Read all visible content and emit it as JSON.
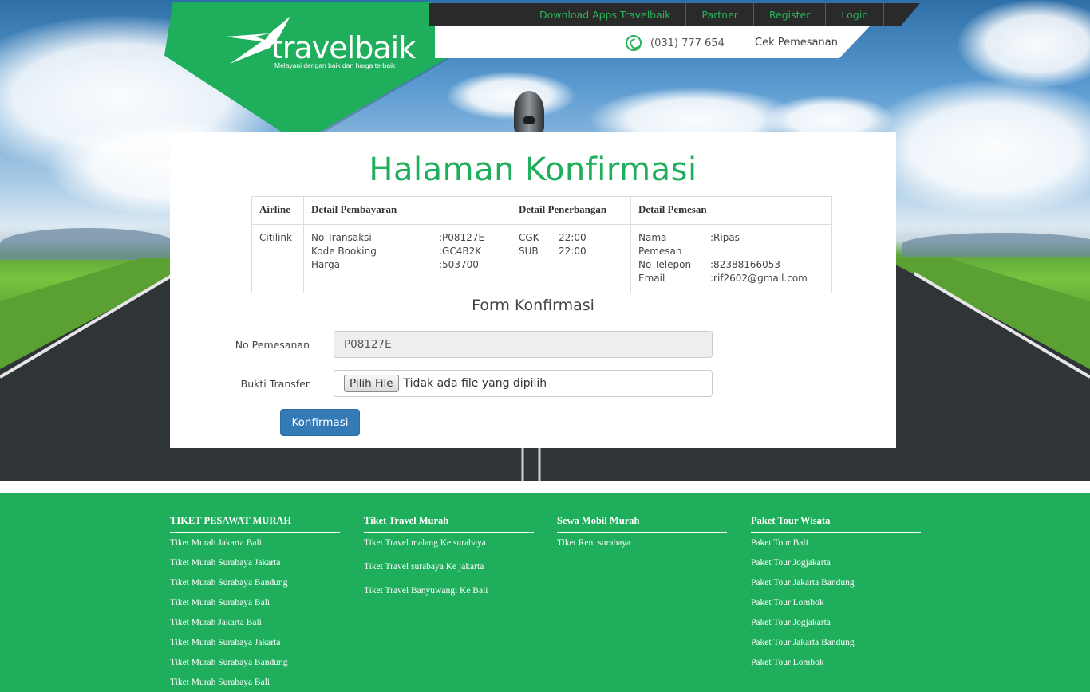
{
  "topnav": {
    "items": [
      "Download Apps Travelbaik",
      "Partner",
      "Register",
      "Login"
    ]
  },
  "contact": {
    "phone": "(031) 777 654",
    "cek_label": "Cek Pemesanan"
  },
  "logo": {
    "name": "travelbaik",
    "tagline": "Melayani dengan baik dan harga terbaik"
  },
  "page_title": "Halaman Konfirmasi",
  "detail_table": {
    "headers": [
      "Airline",
      "Detail Pembayaran",
      "Detail Penerbangan",
      "Detail Pemesan"
    ],
    "airline": "Citilink",
    "payment": [
      {
        "label": "No Transaksi",
        "value": ":P08127E"
      },
      {
        "label": "Kode Booking",
        "value": ":GC4B2K"
      },
      {
        "label": "Harga",
        "value": ":503700"
      }
    ],
    "flight": [
      {
        "code": "CGK",
        "time": "22:00"
      },
      {
        "code": "SUB",
        "time": "22:00"
      }
    ],
    "customer": [
      {
        "label": "Nama Pemesan",
        "value": ":Ripas"
      },
      {
        "label": "No Telepon",
        "value": ":82388166053"
      },
      {
        "label": "Email",
        "value": ":rif2602@gmail.com"
      }
    ]
  },
  "form": {
    "title": "Form Konfirmasi",
    "no_pemesanan_label": "No Pemesanan",
    "no_pemesanan_value": "P08127E",
    "bukti_label": "Bukti Transfer",
    "file_button": "Pilih File",
    "file_status": "Tidak ada file yang dipilih",
    "submit_label": "Konfirmasi"
  },
  "footer": {
    "columns": [
      {
        "heading": "TIKET PESAWAT MURAH",
        "links": [
          "Tiket Murah Jakarta Bali",
          "Tiket Murah Surabaya Jakarta",
          "Tiket Murah Surabaya Bandung",
          "Tiket Murah Surabaya Bali",
          "Tiket Murah Jakarta Bali",
          "Tiket Murah Surabaya Jakarta",
          "Tiket Murah Surabaya Bandung",
          "Tiket Murah Surabaya Bali"
        ]
      },
      {
        "heading": "Tiket Travel Murah",
        "links": [
          "Tiket Travel malang Ke surabaya",
          "Tiket Travel surabaya Ke jakarta",
          "Tiket Travel Banyuwangi Ke Bali"
        ]
      },
      {
        "heading": "Sewa Mobil Murah",
        "links": [
          "Tiket Rent surabaya"
        ]
      },
      {
        "heading": "Paket Tour Wisata",
        "links": [
          "Paket Tour Bali",
          "Paket Tour Jogjakarta",
          "Paket Tour Jakarta Bandung",
          "Paket Tour Lombok",
          "Paket Tour Jogjakarta",
          "Paket Tour Jakarta Bandung",
          "Paket Tour Lombok"
        ]
      }
    ]
  },
  "colors": {
    "brand_green": "#1fae5b",
    "button_blue": "#337ab7",
    "topbar_dark": "#2a2a2a"
  }
}
